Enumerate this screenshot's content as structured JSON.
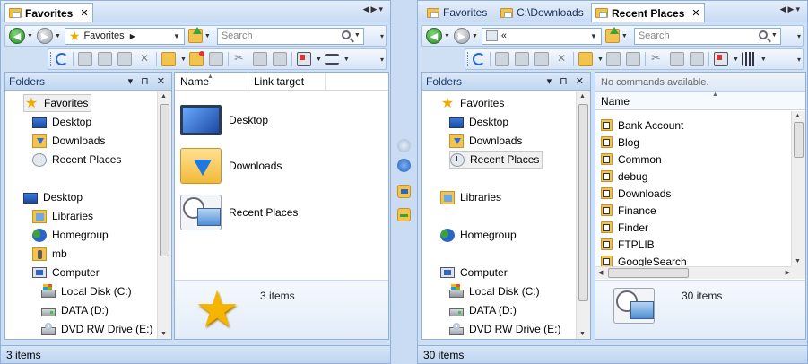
{
  "left": {
    "tabs": [
      {
        "label": "Favorites",
        "close": "✕"
      }
    ],
    "address": {
      "crumb": "Favorites"
    },
    "search": {
      "placeholder": "Search"
    },
    "folders_title": "Folders",
    "folders_controls": "▾ ⊓ ✕",
    "tree": [
      {
        "label": "Favorites",
        "icon": "star-icon"
      },
      {
        "label": "Desktop",
        "icon": "desktop-icon"
      },
      {
        "label": "Downloads",
        "icon": "downloads-icon"
      },
      {
        "label": "Recent Places",
        "icon": "recent-places-icon"
      },
      {
        "label": "Desktop",
        "icon": "desktop-icon"
      },
      {
        "label": "Libraries",
        "icon": "libraries-icon"
      },
      {
        "label": "Homegroup",
        "icon": "homegroup-icon"
      },
      {
        "label": "mb",
        "icon": "user-folder-icon"
      },
      {
        "label": "Computer",
        "icon": "computer-icon"
      },
      {
        "label": "Local Disk (C:)",
        "icon": "local-disk-icon"
      },
      {
        "label": "DATA (D:)",
        "icon": "drive-icon"
      },
      {
        "label": "DVD RW Drive (E:)",
        "icon": "dvd-drive-icon"
      }
    ],
    "columns": [
      "Name",
      "Link target"
    ],
    "items": [
      {
        "label": "Desktop",
        "icon": "desktop-icon"
      },
      {
        "label": "Downloads",
        "icon": "downloads-icon"
      },
      {
        "label": "Recent Places",
        "icon": "recent-places-icon"
      }
    ],
    "details_count": "3 items",
    "status": "3 items"
  },
  "right": {
    "tabs": [
      {
        "label": "Favorites"
      },
      {
        "label": "C:\\Downloads"
      },
      {
        "label": "Recent Places",
        "close": "✕"
      }
    ],
    "address": {
      "crumb": "«"
    },
    "search": {
      "placeholder": "Search"
    },
    "folders_title": "Folders",
    "folders_controls": "▾ ⊓ ✕",
    "tree": [
      {
        "label": "Favorites",
        "icon": "star-icon"
      },
      {
        "label": "Desktop",
        "icon": "desktop-icon"
      },
      {
        "label": "Downloads",
        "icon": "downloads-icon"
      },
      {
        "label": "Recent Places",
        "icon": "recent-places-icon"
      },
      {
        "label": "Libraries",
        "icon": "libraries-icon"
      },
      {
        "label": "Homegroup",
        "icon": "homegroup-icon"
      },
      {
        "label": "Computer",
        "icon": "computer-icon"
      },
      {
        "label": "Local Disk (C:)",
        "icon": "local-disk-icon"
      },
      {
        "label": "DATA (D:)",
        "icon": "drive-icon"
      },
      {
        "label": "DVD RW Drive (E:)",
        "icon": "dvd-drive-icon"
      }
    ],
    "commands_text": "No commands available.",
    "columns": [
      "Name"
    ],
    "list": [
      "Bank Account",
      "Blog",
      "Common",
      "debug",
      "Downloads",
      "Finance",
      "Finder",
      "FTPLIB",
      "GoogleSearch"
    ],
    "details_count": "30 items",
    "status": "30 items"
  }
}
